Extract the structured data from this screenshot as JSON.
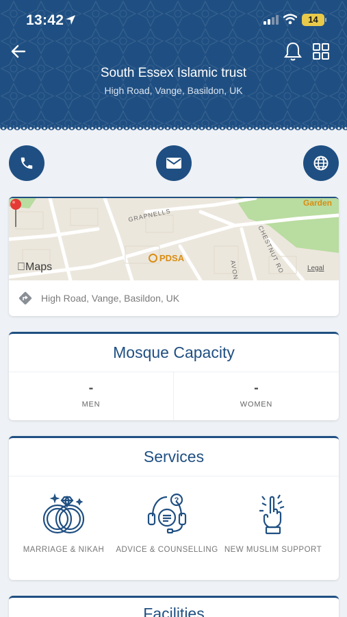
{
  "status_bar": {
    "time": "13:42",
    "battery": "14"
  },
  "header": {
    "title": "South Essex Islamic trust",
    "subtitle": "High Road, Vange, Basildon, UK"
  },
  "map": {
    "provider_label": "Maps",
    "legal_label": "Legal",
    "street_labels": [
      "GRAPNELLS",
      "CHESTNUT RO",
      "AVON"
    ],
    "poi_pdsa": "PDSA",
    "poi_garden": "Garden",
    "address": "High Road, Vange, Basildon, UK"
  },
  "capacity": {
    "heading": "Mosque Capacity",
    "men_value": "-",
    "men_label": "MEN",
    "women_value": "-",
    "women_label": "WOMEN"
  },
  "services": {
    "heading": "Services",
    "items": [
      {
        "label": "MARRIAGE & NIKAH",
        "icon": "rings-icon"
      },
      {
        "label": "ADVICE & COUNSELLING",
        "icon": "headset-question-icon"
      },
      {
        "label": "NEW MUSLIM SUPPORT",
        "icon": "raised-finger-icon"
      }
    ]
  },
  "facilities": {
    "heading": "Facilities"
  },
  "colors": {
    "primary": "#1f4f82",
    "background": "#eef1f5",
    "accent": "#d98d12"
  }
}
